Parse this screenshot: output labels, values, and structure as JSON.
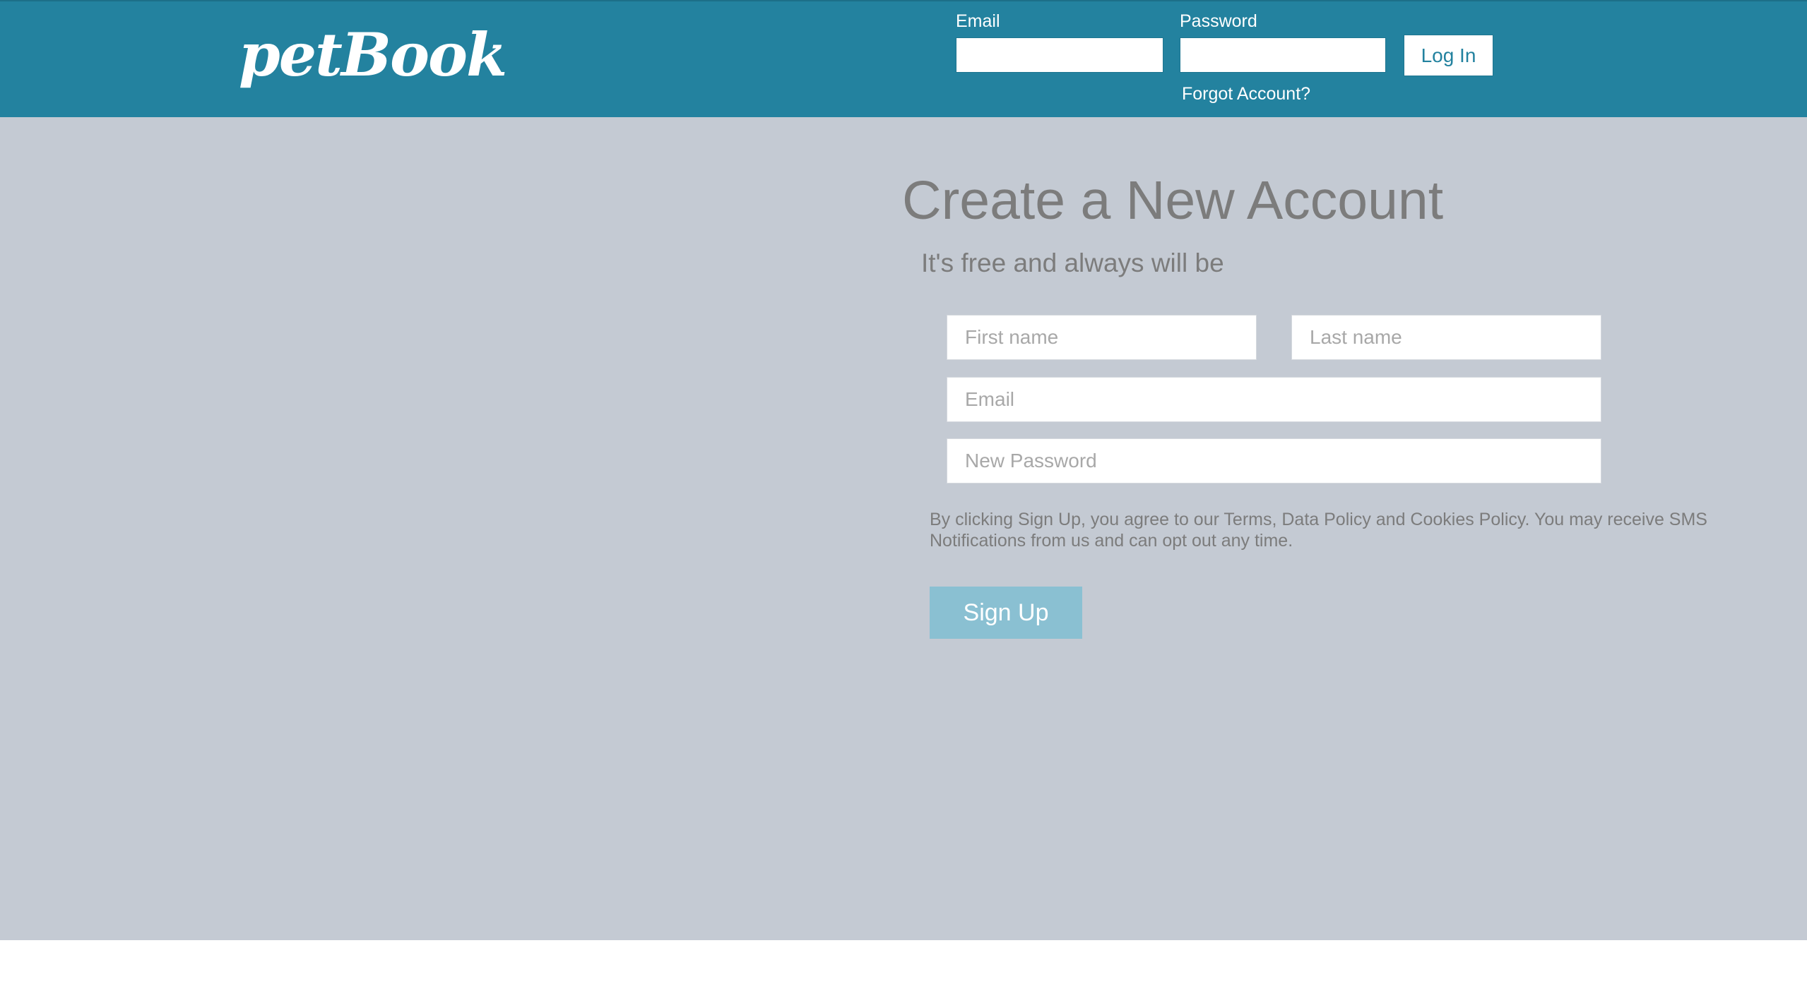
{
  "header": {
    "logo": "petBook",
    "email_label": "Email",
    "email_value": "",
    "password_label": "Password",
    "password_value": "",
    "login_label": "Log In",
    "forgot_label": "Forgot Account?"
  },
  "signup": {
    "title": "Create a New Account",
    "subtitle": "It's free and always will be",
    "first_name_placeholder": "First name",
    "last_name_placeholder": "Last name",
    "email_placeholder": "Email",
    "password_placeholder": "New Password",
    "terms": "By clicking Sign Up, you agree to our Terms, Data Policy and Cookies Policy. You may receive SMS Notifications from us and can opt out any time.",
    "button_label": "Sign Up"
  },
  "colors": {
    "header_bg": "#23829f",
    "main_bg": "#c4cad3",
    "signup_button": "#8ac0d2",
    "text_gray": "#7c7c7c"
  }
}
